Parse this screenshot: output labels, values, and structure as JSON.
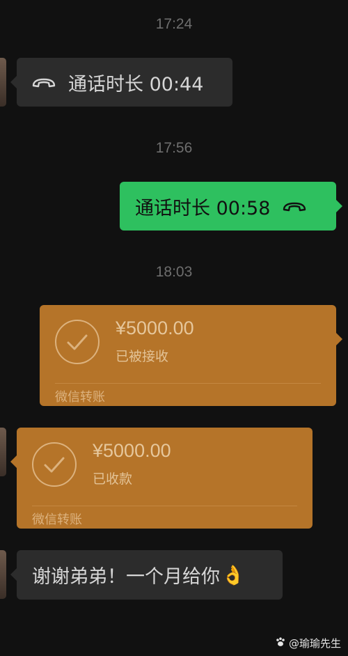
{
  "messages": {
    "t1": "17:24",
    "call_in": "通话时长 00:44",
    "t2": "17:56",
    "call_out": "通话时长 00:58",
    "t3": "18:03",
    "transfer1": {
      "amount": "¥5000.00",
      "status": "已被接收",
      "footer": "微信转账"
    },
    "transfer2": {
      "amount": "¥5000.00",
      "status": "已收款",
      "footer": "微信转账"
    },
    "text_in": "谢谢弟弟！一个月给你",
    "text_emoji": "👌"
  },
  "watermark": {
    "icon": "paw-icon",
    "text": "@瑜瑜先生"
  },
  "colors": {
    "background": "#111111",
    "green_bubble": "#2ec05f",
    "dark_bubble": "#2c2c2c",
    "transfer_bubble": "#b57429"
  }
}
